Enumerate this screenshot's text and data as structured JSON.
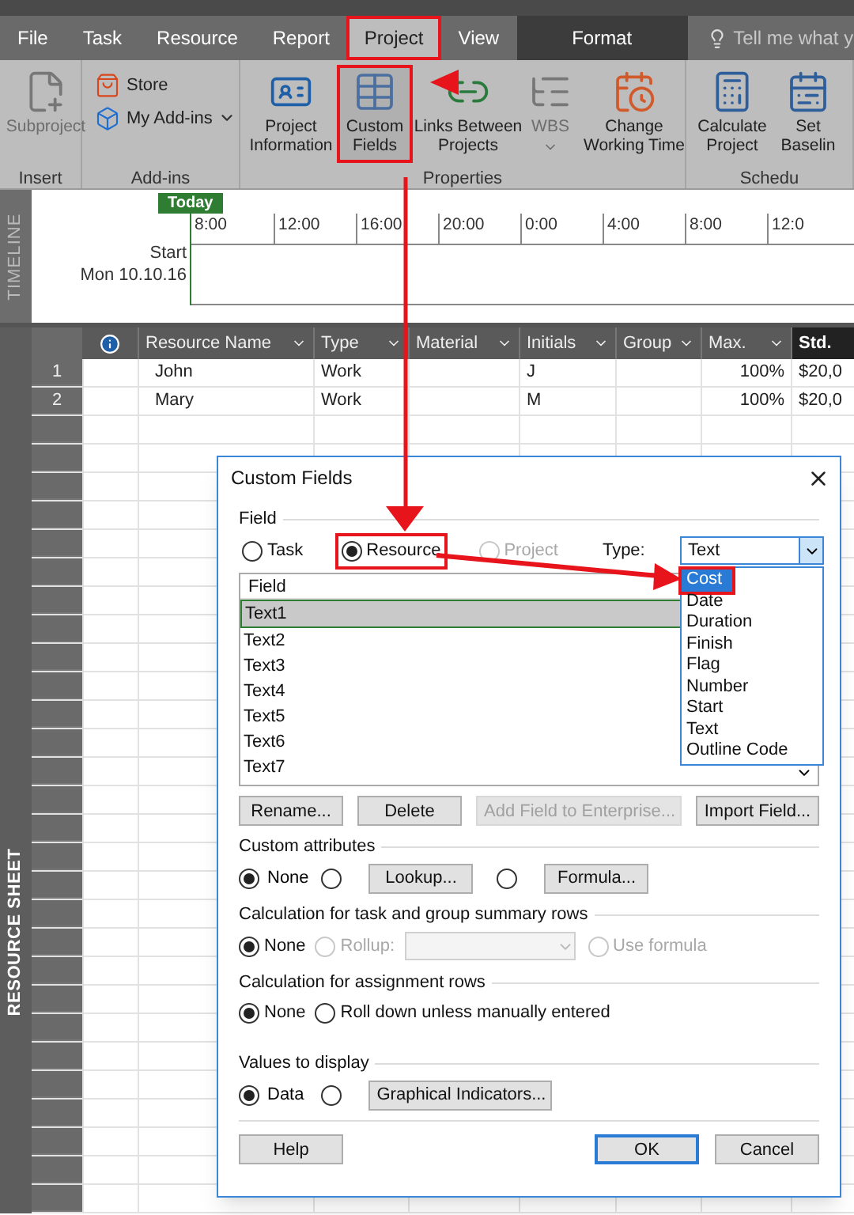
{
  "ribbon_tabs": [
    {
      "label": "File",
      "selected": false,
      "kind": "normal"
    },
    {
      "label": "Task",
      "selected": false,
      "kind": "normal"
    },
    {
      "label": "Resource",
      "selected": false,
      "kind": "normal"
    },
    {
      "label": "Report",
      "selected": false,
      "kind": "normal"
    },
    {
      "label": "Project",
      "selected": true,
      "kind": "normal",
      "highlighted": true
    },
    {
      "label": "View",
      "selected": false,
      "kind": "normal"
    },
    {
      "label": "Format",
      "selected": false,
      "kind": "contextual"
    }
  ],
  "tell_me": {
    "placeholder": "Tell me what y"
  },
  "ribbon_groups": [
    {
      "label": "Insert",
      "commands": [
        {
          "label": "Subproject",
          "kind": "large",
          "disabled": true
        }
      ]
    },
    {
      "label": "Add-ins",
      "commands": [
        {
          "label": "Store",
          "kind": "small"
        },
        {
          "label": "My Add-ins",
          "kind": "small",
          "dropdown": true
        }
      ]
    },
    {
      "label": "Properties",
      "commands": [
        {
          "label": "Project Information",
          "kind": "large"
        },
        {
          "label": "Custom Fields",
          "kind": "large",
          "highlighted": true
        },
        {
          "label": "Links Between Projects",
          "kind": "large"
        },
        {
          "label": "WBS",
          "kind": "large",
          "disabled": true,
          "dropdown": true
        },
        {
          "label": "Change Working Time",
          "kind": "large"
        }
      ]
    },
    {
      "label": "Schedu",
      "commands": [
        {
          "label": "Calculate Project",
          "kind": "large"
        },
        {
          "label": "Set Baselin",
          "kind": "large"
        }
      ]
    }
  ],
  "timeline": {
    "side_label": "TIMELINE",
    "today": "Today",
    "ticks": [
      "8:00",
      "12:00",
      "16:00",
      "20:00",
      "0:00",
      "4:00",
      "8:00",
      "12:0"
    ],
    "start_label": "Start",
    "start_date": "Mon 10.10.16"
  },
  "sheet": {
    "side_label": "RESOURCE SHEET",
    "columns": [
      {
        "label": "Resource Name",
        "selected": false
      },
      {
        "label": "Type",
        "selected": false
      },
      {
        "label": "Material",
        "selected": false
      },
      {
        "label": "Initials",
        "selected": false
      },
      {
        "label": "Group",
        "selected": false
      },
      {
        "label": "Max.",
        "selected": false
      },
      {
        "label": "Std.",
        "selected": true
      }
    ],
    "rows": [
      {
        "number": "1",
        "name": "John",
        "type": "Work",
        "initials": "J",
        "max": "100%",
        "std": "$20,0"
      },
      {
        "number": "2",
        "name": "Mary",
        "type": "Work",
        "initials": "M",
        "max": "100%",
        "std": "$20,0"
      }
    ]
  },
  "dialog": {
    "title": "Custom Fields",
    "field_section": "Field",
    "field_radios": [
      {
        "label": "Task",
        "selected": false
      },
      {
        "label": "Resource",
        "selected": true,
        "highlighted": true
      },
      {
        "label": "Project",
        "selected": false,
        "disabled": true
      }
    ],
    "type_label": "Type:",
    "type_select": {
      "value": "Text",
      "expanded": true
    },
    "type_options": [
      {
        "label": "Cost",
        "selected": true,
        "highlighted": true
      },
      {
        "label": "Date",
        "selected": false
      },
      {
        "label": "Duration",
        "selected": false
      },
      {
        "label": "Finish",
        "selected": false
      },
      {
        "label": "Flag",
        "selected": false
      },
      {
        "label": "Number",
        "selected": false
      },
      {
        "label": "Start",
        "selected": false
      },
      {
        "label": "Text",
        "selected": false
      },
      {
        "label": "Outline Code",
        "selected": false
      }
    ],
    "field_list_header": "Field",
    "field_list": [
      {
        "label": "Text1",
        "selected": true
      },
      {
        "label": "Text2",
        "selected": false
      },
      {
        "label": "Text3",
        "selected": false
      },
      {
        "label": "Text4",
        "selected": false
      },
      {
        "label": "Text5",
        "selected": false
      },
      {
        "label": "Text6",
        "selected": false
      },
      {
        "label": "Text7",
        "selected": false
      }
    ],
    "list_buttons": [
      {
        "label": "Rename...",
        "disabled": false
      },
      {
        "label": "Delete",
        "disabled": false
      },
      {
        "label": "Add Field to Enterprise...",
        "disabled": true
      },
      {
        "label": "Import Field...",
        "disabled": false
      }
    ],
    "custom_attributes": {
      "title": "Custom attributes",
      "none_label": "None",
      "options": [
        {
          "selected": true
        },
        {
          "selected": false,
          "button": "Lookup..."
        },
        {
          "selected": false,
          "button": "Formula..."
        }
      ]
    },
    "task_summary": {
      "title": "Calculation for task and group summary rows",
      "options": [
        {
          "label": "None",
          "selected": true,
          "disabled": false
        },
        {
          "label": "Rollup:",
          "selected": false,
          "disabled": true
        },
        {
          "label": "Use formula",
          "selected": false,
          "disabled": true
        }
      ]
    },
    "assignment_rows": {
      "title": "Calculation for assignment rows",
      "options": [
        {
          "label": "None",
          "selected": true
        },
        {
          "label": "Roll down unless manually entered",
          "selected": false
        }
      ]
    },
    "values_display": {
      "title": "Values to display",
      "options": [
        {
          "label": "Data",
          "selected": true
        },
        {
          "selected": false,
          "button": "Graphical Indicators..."
        }
      ]
    },
    "footer_buttons": [
      {
        "label": "Help",
        "default": false
      },
      {
        "label": "OK",
        "default": true
      },
      {
        "label": "Cancel",
        "default": false
      }
    ]
  }
}
